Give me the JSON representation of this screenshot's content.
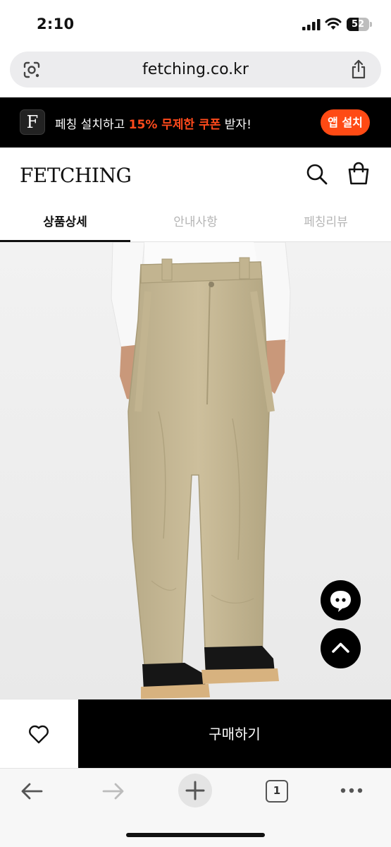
{
  "status_bar": {
    "time": "2:10",
    "battery": "52",
    "battery_level": 0.52
  },
  "browser": {
    "url": "fetching.co.kr",
    "tab_count": "1"
  },
  "promo": {
    "prefix": "페칭 설치하고 ",
    "highlight": "15% 무제한 쿠폰",
    "suffix": " 받자!",
    "install_label": "앱 설치",
    "logo_letter": "F",
    "accent_color": "#ff4a14"
  },
  "header": {
    "brand": "FETCHING"
  },
  "tabs": [
    {
      "label": "상품상세",
      "active": true
    },
    {
      "label": "안내사항",
      "active": false
    },
    {
      "label": "페칭리뷰",
      "active": false
    }
  ],
  "actions": {
    "buy_label": "구매하기"
  },
  "icons": {
    "lens": "google-lens-icon",
    "share": "share-icon",
    "search": "search-icon",
    "bag": "shopping-bag-icon",
    "chat": "chat-bubble-icon",
    "top": "chevron-up-icon",
    "heart": "heart-icon",
    "back": "arrow-left-icon",
    "forward": "arrow-right-icon",
    "new_tab": "plus-icon",
    "more": "more-icon"
  }
}
